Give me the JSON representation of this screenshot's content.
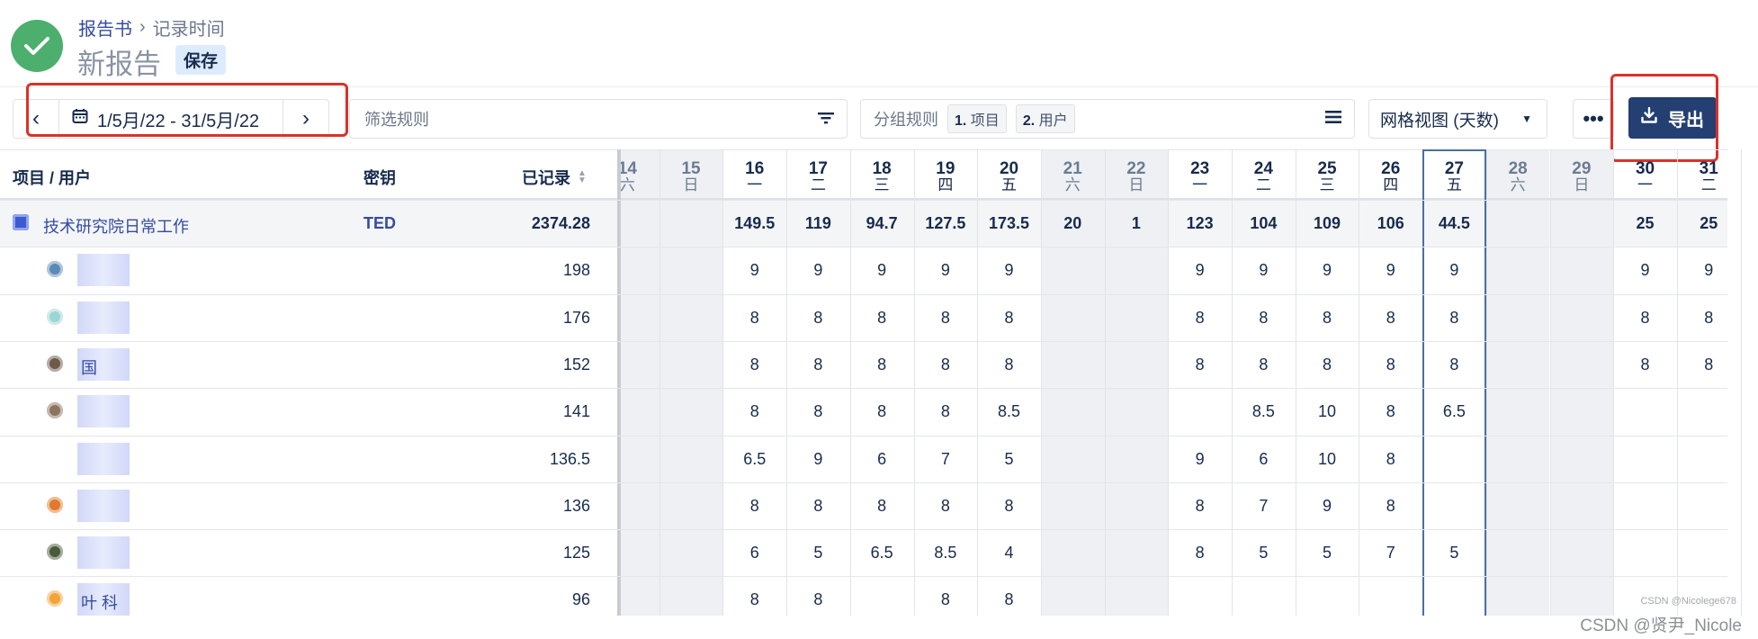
{
  "header": {
    "breadcrumb_root": "报告书",
    "breadcrumb_sep": "›",
    "breadcrumb_current": "记录时间",
    "title": "新报告",
    "save_label": "保存"
  },
  "toolbar": {
    "date_range": "1/5月/22 - 31/5月/22",
    "filter_placeholder": "筛选规则",
    "group_label": "分组规则",
    "group_chips": [
      {
        "num": "1.",
        "label": "项目"
      },
      {
        "num": "2.",
        "label": "用户"
      }
    ],
    "view_label": "网格视图 (天数)",
    "more_label": "•••",
    "export_label": "导出"
  },
  "table": {
    "col_project": "项目 / 用户",
    "col_key": "密钥",
    "col_logged": "已记录",
    "days": [
      {
        "num": "14",
        "wd": "六",
        "weekend": true
      },
      {
        "num": "15",
        "wd": "日",
        "weekend": true
      },
      {
        "num": "16",
        "wd": "一",
        "weekend": false
      },
      {
        "num": "17",
        "wd": "二",
        "weekend": false
      },
      {
        "num": "18",
        "wd": "三",
        "weekend": false
      },
      {
        "num": "19",
        "wd": "四",
        "weekend": false
      },
      {
        "num": "20",
        "wd": "五",
        "weekend": false
      },
      {
        "num": "21",
        "wd": "六",
        "weekend": true
      },
      {
        "num": "22",
        "wd": "日",
        "weekend": true
      },
      {
        "num": "23",
        "wd": "一",
        "weekend": false
      },
      {
        "num": "24",
        "wd": "二",
        "weekend": false
      },
      {
        "num": "25",
        "wd": "三",
        "weekend": false
      },
      {
        "num": "26",
        "wd": "四",
        "weekend": false
      },
      {
        "num": "27",
        "wd": "五",
        "weekend": false,
        "today": true
      },
      {
        "num": "28",
        "wd": "六",
        "weekend": true
      },
      {
        "num": "29",
        "wd": "日",
        "weekend": true
      },
      {
        "num": "30",
        "wd": "一",
        "weekend": false
      },
      {
        "num": "31",
        "wd": "二",
        "weekend": false
      }
    ],
    "project": {
      "name": "技术研究院日常工作",
      "key": "TED",
      "total": "2374.28",
      "daily": [
        "",
        "",
        "149.5",
        "119",
        "94.7",
        "127.5",
        "173.5",
        "20",
        "1",
        "123",
        "104",
        "109",
        "106",
        "44.5",
        "",
        "",
        "25",
        "25"
      ]
    },
    "users": [
      {
        "name_visible": "",
        "total": "198",
        "avatar_color": "#5b8ab5",
        "daily": [
          "",
          "",
          "9",
          "9",
          "9",
          "9",
          "9",
          "",
          "",
          "9",
          "9",
          "9",
          "9",
          "9",
          "",
          "",
          "9",
          "9"
        ]
      },
      {
        "name_visible": "",
        "total": "176",
        "avatar_color": "#9ad7d2",
        "daily": [
          "",
          "",
          "8",
          "8",
          "8",
          "8",
          "8",
          "",
          "",
          "8",
          "8",
          "8",
          "8",
          "8",
          "",
          "",
          "8",
          "8"
        ]
      },
      {
        "name_visible": "国",
        "total": "152",
        "avatar_color": "#6d5a4a",
        "daily": [
          "",
          "",
          "8",
          "8",
          "8",
          "8",
          "8",
          "",
          "",
          "8",
          "8",
          "8",
          "8",
          "8",
          "",
          "",
          "8",
          "8"
        ]
      },
      {
        "name_visible": "",
        "total": "141",
        "avatar_color": "#8a7560",
        "daily": [
          "",
          "",
          "8",
          "8",
          "8",
          "8",
          "8.5",
          "",
          "",
          "",
          "8.5",
          "10",
          "8",
          "6.5",
          "",
          "",
          "",
          ""
        ]
      },
      {
        "name_visible": "",
        "total": "136.5",
        "avatar_color": "",
        "daily": [
          "",
          "",
          "6.5",
          "9",
          "6",
          "7",
          "5",
          "",
          "",
          "9",
          "6",
          "10",
          "8",
          "",
          "",
          "",
          "",
          ""
        ]
      },
      {
        "name_visible": "",
        "total": "136",
        "avatar_color": "#e07a2e",
        "daily": [
          "",
          "",
          "8",
          "8",
          "8",
          "8",
          "8",
          "",
          "",
          "8",
          "7",
          "9",
          "8",
          "",
          "",
          "",
          "",
          ""
        ]
      },
      {
        "name_visible": "",
        "total": "125",
        "avatar_color": "#4a5a3a",
        "daily": [
          "",
          "",
          "6",
          "5",
          "6.5",
          "8.5",
          "4",
          "",
          "",
          "8",
          "5",
          "5",
          "7",
          "5",
          "",
          "",
          "",
          ""
        ]
      },
      {
        "name_visible": "叶 科",
        "total": "96",
        "avatar_color": "#f0a43a",
        "daily": [
          "",
          "",
          "8",
          "8",
          "",
          "8",
          "8",
          "",
          "",
          "",
          "",
          "",
          "",
          "",
          "",
          "",
          "",
          ""
        ]
      }
    ]
  },
  "watermark": {
    "small": "CSDN @Nicolege678",
    "large": "CSDN @贤尹_Nicole"
  },
  "colors": {
    "accent": "#344ba3",
    "export_bg": "#243f71",
    "logo_green": "#4caf6e",
    "highlight_red": "#d9322b",
    "today_border": "#4a6fa5"
  }
}
